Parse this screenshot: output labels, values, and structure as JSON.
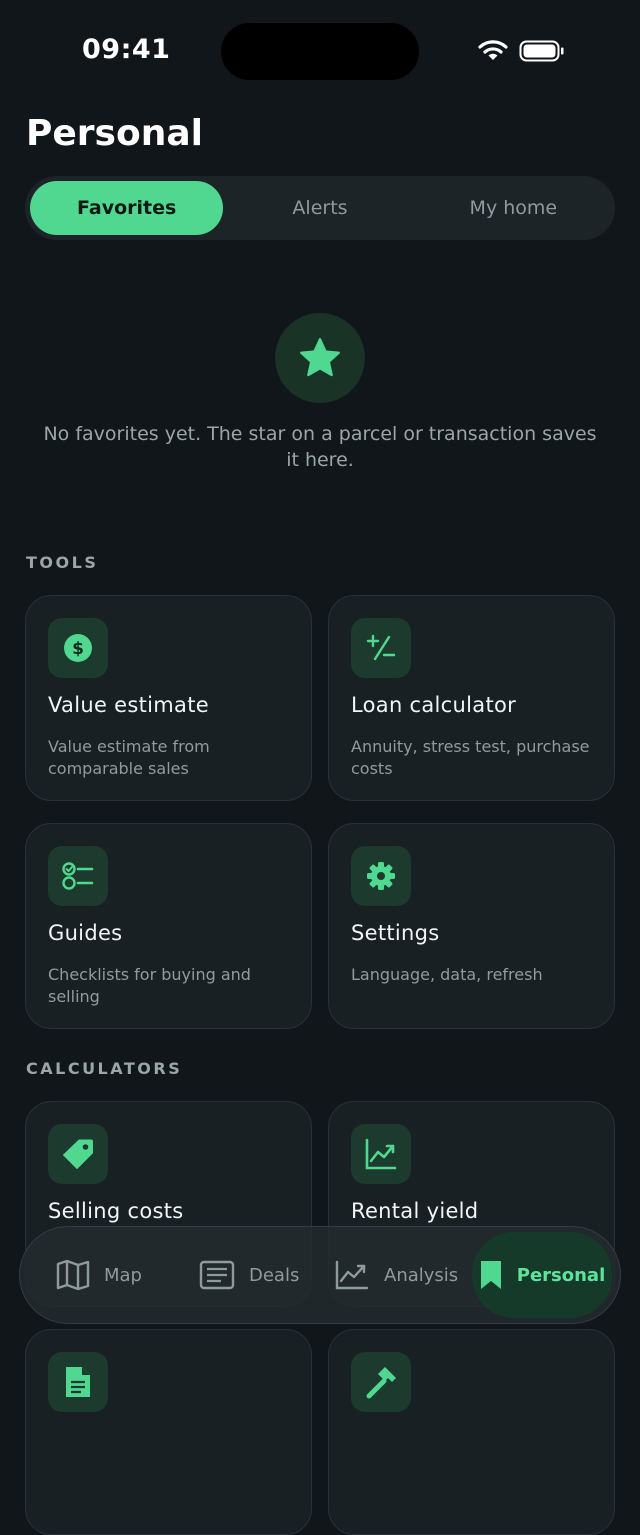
{
  "status": {
    "time": "09:41"
  },
  "title": "Personal",
  "segments": [
    {
      "label": "Favorites",
      "active": true
    },
    {
      "label": "Alerts",
      "active": false
    },
    {
      "label": "My home",
      "active": false
    }
  ],
  "empty_state": {
    "icon": "star-icon",
    "text": "No favorites yet. The star on a parcel or transaction saves it here."
  },
  "sections": {
    "tools": "TOOLS",
    "calculators": "CALCULATORS"
  },
  "tools": [
    {
      "icon": "dollar-icon",
      "title": "Value estimate",
      "desc": "Value estimate from comparable sales"
    },
    {
      "icon": "plus-minus-icon",
      "title": "Loan calculator",
      "desc": "Annuity, stress test, purchase costs"
    },
    {
      "icon": "checklist-icon",
      "title": "Guides",
      "desc": "Checklists for buying and selling"
    },
    {
      "icon": "gear-icon",
      "title": "Settings",
      "desc": "Language, data, refresh"
    }
  ],
  "calculators": [
    {
      "icon": "tag-icon",
      "title": "Selling costs"
    },
    {
      "icon": "chart-icon",
      "title": "Rental yield"
    },
    {
      "icon": "document-icon",
      "title": ""
    },
    {
      "icon": "hammer-icon",
      "title": ""
    }
  ],
  "tabbar": [
    {
      "icon": "map-icon",
      "label": "Map",
      "active": false
    },
    {
      "icon": "list-icon",
      "label": "Deals",
      "active": false
    },
    {
      "icon": "trend-icon",
      "label": "Analysis",
      "active": false
    },
    {
      "icon": "bookmark-icon",
      "label": "Personal",
      "active": true
    }
  ],
  "colors": {
    "background": "#11161a",
    "accent": "#50d890",
    "card": "#192024",
    "icon_bg": "#1c3a2d"
  }
}
